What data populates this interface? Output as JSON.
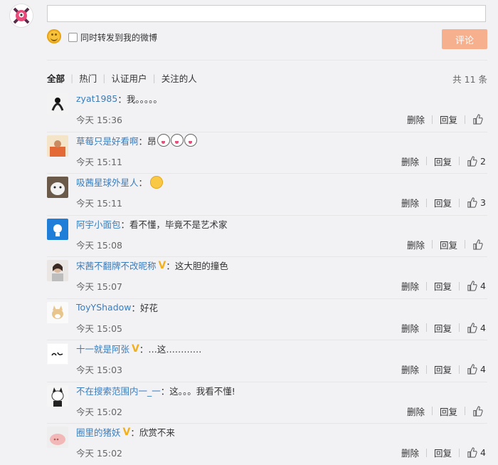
{
  "composer": {
    "repost_label": "同时转发到我的微博",
    "submit_label": "评论"
  },
  "filters": {
    "tabs": [
      "全部",
      "热门",
      "认证用户",
      "关注的人"
    ],
    "total": "共 11 条"
  },
  "comments": [
    {
      "user": "zyat1985",
      "text": "我。。。。。",
      "time": "今天 15:36",
      "delete": "删除",
      "reply": "回复",
      "likes": ""
    },
    {
      "user": "草莓只是好看啊",
      "text": "昂",
      "time": "今天 15:11",
      "delete": "删除",
      "reply": "回复",
      "likes": "2"
    },
    {
      "user": "吸茜星球外星人",
      "text": "",
      "time": "今天 15:11",
      "delete": "删除",
      "reply": "回复",
      "likes": "3"
    },
    {
      "user": "阿宇小面包",
      "text": "看不懂，毕竟不是艺术家",
      "time": "今天 15:08",
      "delete": "删除",
      "reply": "回复",
      "likes": ""
    },
    {
      "user": "宋茜不翻牌不改昵称",
      "text": "这大胆的撞色",
      "time": "今天 15:07",
      "delete": "删除",
      "reply": "回复",
      "likes": "4"
    },
    {
      "user": "ToyYShadow",
      "text": "好花",
      "time": "今天 15:05",
      "delete": "删除",
      "reply": "回复",
      "likes": "4"
    },
    {
      "user": "十一就是阿张",
      "text": "…这…………",
      "time": "今天 15:03",
      "delete": "删除",
      "reply": "回复",
      "likes": "4"
    },
    {
      "user": "不在搜索范围内一_一",
      "text": "这。。。我看不懂!",
      "time": "今天 15:02",
      "delete": "删除",
      "reply": "回复",
      "likes": ""
    },
    {
      "user": "圈里的猪妖",
      "text": "欣赏不来",
      "time": "今天 15:02",
      "delete": "删除",
      "reply": "回复",
      "likes": "4"
    }
  ]
}
